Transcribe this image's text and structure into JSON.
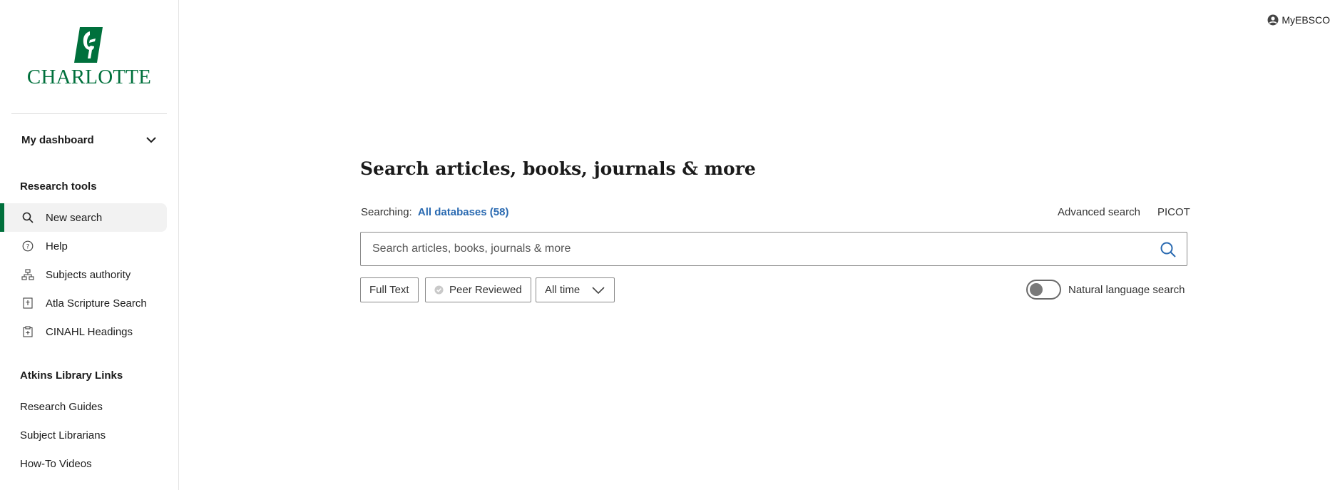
{
  "sidebar": {
    "logo_text": "CHARLOTTE",
    "dashboard_label": "My dashboard",
    "research_tools_title": "Research tools",
    "research_tools": [
      {
        "label": "New search",
        "icon": "search-icon",
        "active": true
      },
      {
        "label": "Help",
        "icon": "help-icon",
        "active": false
      },
      {
        "label": "Subjects authority",
        "icon": "hierarchy-icon",
        "active": false
      },
      {
        "label": "Atla Scripture Search",
        "icon": "book-icon",
        "active": false
      },
      {
        "label": "CINAHL Headings",
        "icon": "clipboard-icon",
        "active": false
      }
    ],
    "library_links_title": "Atkins Library Links",
    "library_links": [
      {
        "label": "Research Guides"
      },
      {
        "label": "Subject Librarians"
      },
      {
        "label": "How-To Videos"
      }
    ]
  },
  "header": {
    "account_label": "MyEBSCO"
  },
  "main": {
    "headline": "Search articles, books, journals & more",
    "searching_label": "Searching:",
    "databases_link": "All databases (58)",
    "advanced_search": "Advanced search",
    "picot": "PICOT",
    "search_placeholder": "Search articles, books, journals & more",
    "search_value": "",
    "filters": {
      "full_text": "Full Text",
      "peer_reviewed": "Peer Reviewed",
      "date_range": "All time"
    },
    "natural_language_label": "Natural language search",
    "natural_language_enabled": false
  },
  "colors": {
    "brand_green": "#00703c",
    "link_blue": "#2a6ab1"
  }
}
